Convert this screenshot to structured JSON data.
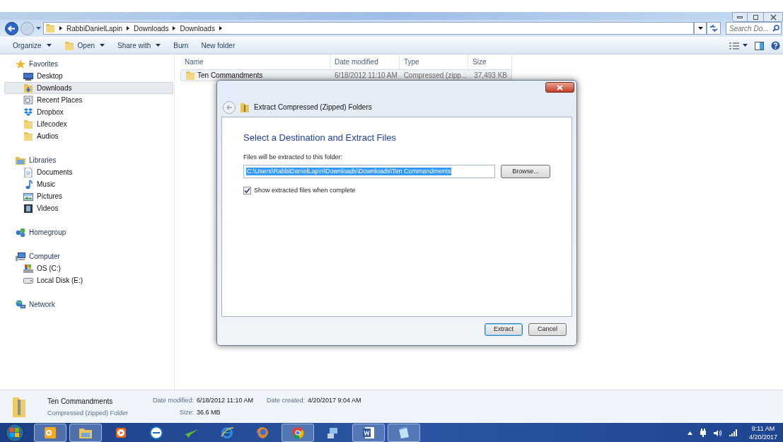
{
  "address_bar": {
    "crumbs": [
      "RabbiDanielLapin",
      "Downloads",
      "Downloads"
    ],
    "search_placeholder": "Search Do..."
  },
  "toolbar": {
    "items": [
      {
        "label": "Organize",
        "kind": "menu",
        "icon": false
      },
      {
        "label": "Open",
        "kind": "menu",
        "icon": true
      },
      {
        "label": "Share with",
        "kind": "menu",
        "icon": false
      },
      {
        "label": "Burn",
        "kind": "plain",
        "icon": false
      },
      {
        "label": "New folder",
        "kind": "plain",
        "icon": false
      }
    ]
  },
  "sidebar": {
    "groups": [
      {
        "label": "Favorites",
        "kind": "star",
        "items": [
          {
            "label": "Desktop",
            "kind": "desktop",
            "selected": false
          },
          {
            "label": "Downloads",
            "kind": "download",
            "selected": true
          },
          {
            "label": "Recent Places",
            "kind": "recent",
            "selected": false
          },
          {
            "label": "Dropbox",
            "kind": "dropbox",
            "selected": false
          },
          {
            "label": "Lifecodex",
            "kind": "folder",
            "selected": false
          },
          {
            "label": "Audios",
            "kind": "folder",
            "selected": false
          }
        ]
      },
      {
        "label": "Libraries",
        "kind": "library",
        "items": [
          {
            "label": "Documents",
            "kind": "document",
            "selected": false
          },
          {
            "label": "Music",
            "kind": "music",
            "selected": false
          },
          {
            "label": "Pictures",
            "kind": "picture",
            "selected": false
          },
          {
            "label": "Videos",
            "kind": "video",
            "selected": false
          }
        ]
      },
      {
        "label": "Homegroup",
        "kind": "homegroup"
      },
      {
        "label": "Computer",
        "kind": "computer",
        "items": [
          {
            "label": "OS (C:)",
            "kind": "osdrive",
            "selected": false
          },
          {
            "label": "Local Disk (E:)",
            "kind": "drive",
            "selected": false
          }
        ]
      },
      {
        "label": "Network",
        "kind": "network"
      }
    ]
  },
  "file_list": {
    "columns": [
      "Name",
      "Date modified",
      "Type",
      "Size"
    ],
    "rows": [
      {
        "cells": [
          "Ten Commandments",
          "6/18/2012 11:10 AM",
          "Compressed (zipp...",
          "37,493 KB"
        ],
        "selected": true
      }
    ]
  },
  "dialog": {
    "title": "Extract Compressed (Zipped) Folders",
    "heading": "Select a Destination and Extract Files",
    "field_label": "Files will be extracted to this folder:",
    "path": "C:\\Users\\RabbiDanielLapin\\Downloads\\Downloads\\Ten Commandments",
    "path_text_selected": true,
    "browse": "Browse...",
    "show_files_label": "Show extracted files when complete",
    "show_files_checked": true,
    "buttons": [
      {
        "label": "Extract",
        "default": true
      },
      {
        "label": "Cancel",
        "default": false
      }
    ]
  },
  "details": {
    "name": "Ten Commandments",
    "type": "Compressed (zipped) Folder",
    "fields": [
      {
        "label": "Date modified:",
        "value": "6/18/2012 11:10 AM"
      },
      {
        "label": "Size:",
        "value": "36.6 MB"
      },
      {
        "label": "Date created:",
        "value": "4/20/2017 9:04 AM"
      }
    ]
  },
  "taskbar": {
    "apps": [
      {
        "kind": "outlook",
        "running": true
      },
      {
        "kind": "explorer",
        "running": true
      },
      {
        "kind": "media",
        "running": false
      },
      {
        "kind": "dell",
        "running": false
      },
      {
        "kind": "plane",
        "running": false
      },
      {
        "kind": "ie",
        "running": false
      },
      {
        "kind": "firefox",
        "running": false
      },
      {
        "kind": "chrome",
        "running": true
      },
      {
        "kind": "network",
        "running": false
      },
      {
        "kind": "word",
        "running": true
      },
      {
        "kind": "notepad",
        "running": true
      }
    ],
    "time": "9:11 AM",
    "date": "4/20/2017"
  }
}
